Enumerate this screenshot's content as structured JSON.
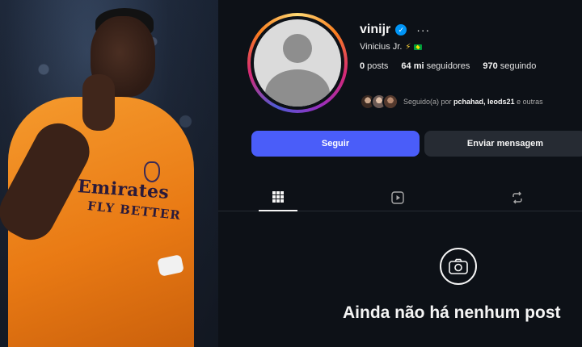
{
  "profile": {
    "username": "vinijr",
    "verified_icon": "verified-badge-icon",
    "more_label": "···",
    "full_name": "Vinicius Jr.",
    "stats": {
      "posts_value": "0",
      "posts_label": "posts",
      "followers_value": "64 mi",
      "followers_label": "seguidores",
      "following_value": "970",
      "following_label": "seguindo"
    },
    "followed_by": {
      "prefix": "Seguido(a) por ",
      "names": "pchahad, leods21",
      "suffix": " e outras"
    },
    "buttons": {
      "follow": "Seguir",
      "message": "Enviar mensagem"
    },
    "tabs": [
      "grid-icon",
      "reels-icon",
      "tagged-icon"
    ],
    "empty_state": {
      "icon": "camera-icon",
      "title": "Ainda não há nenhum post"
    }
  },
  "photo": {
    "sponsor_line1": "Emirates",
    "sponsor_line2": "FLY BETTER"
  },
  "colors": {
    "accent": "#4a5df9",
    "background": "#0d1117",
    "verified": "#0095f6"
  }
}
